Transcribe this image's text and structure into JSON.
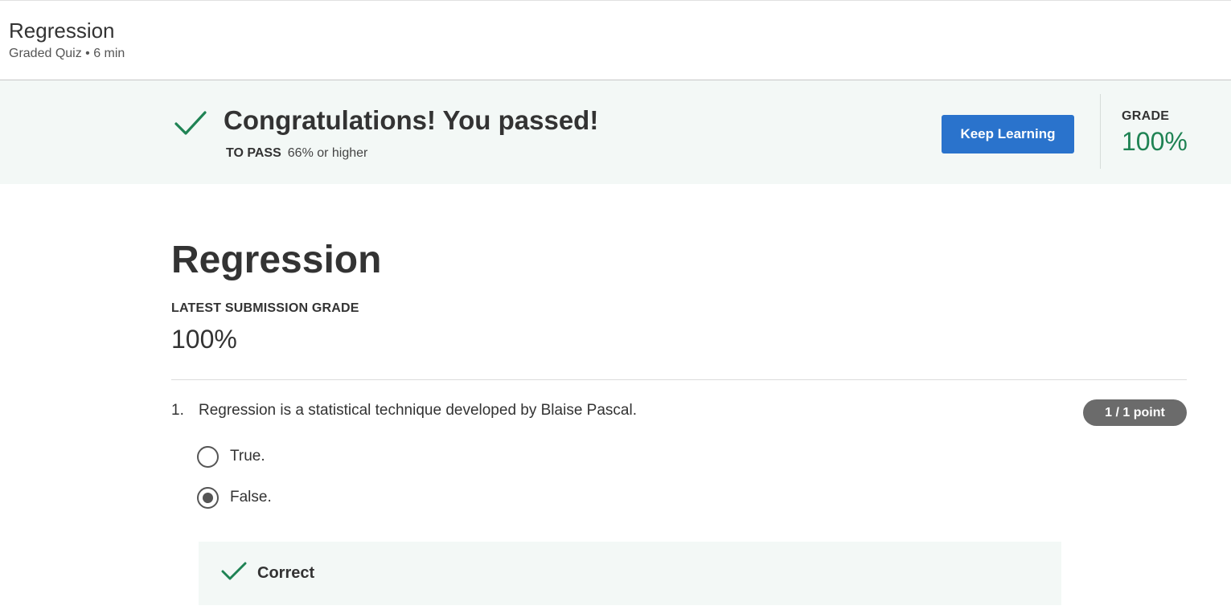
{
  "header": {
    "title": "Regression",
    "subtitle": "Graded Quiz • 6 min"
  },
  "banner": {
    "title": "Congratulations! You passed!",
    "to_pass_label": "TO PASS",
    "to_pass_value": "66% or higher",
    "button_label": "Keep Learning",
    "grade_label": "GRADE",
    "grade_value": "100%",
    "accent_color": "#1f8354",
    "button_color": "#2a73cc",
    "icon": "check-icon"
  },
  "main": {
    "title": "Regression",
    "latest_label": "LATEST SUBMISSION GRADE",
    "latest_value": "100%"
  },
  "question": {
    "number": "1.",
    "text": "Regression is a statistical technique developed by Blaise Pascal.",
    "points": "1 / 1 point",
    "options": [
      {
        "label": "True.",
        "selected": false
      },
      {
        "label": "False.",
        "selected": true
      }
    ],
    "feedback": {
      "label": "Correct",
      "icon": "check-icon"
    }
  }
}
